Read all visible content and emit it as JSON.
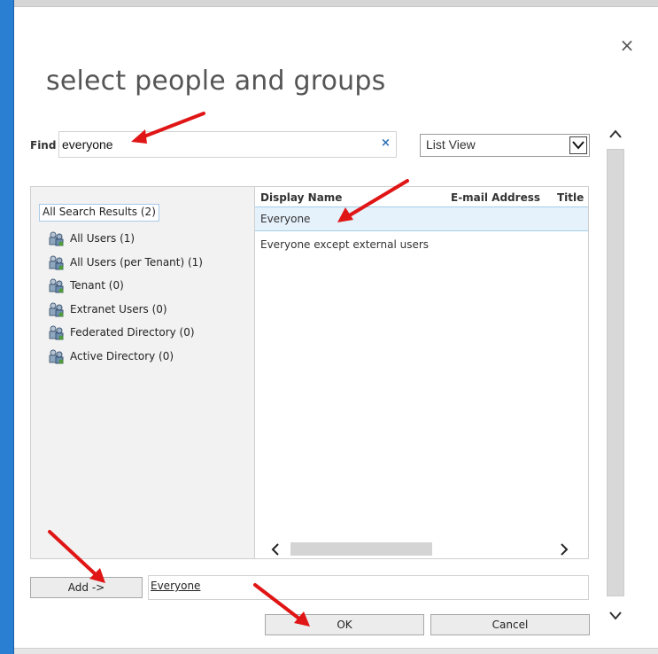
{
  "dialog": {
    "title": "select people and groups",
    "close_glyph": "×"
  },
  "find": {
    "label": "Find",
    "value": "everyone",
    "clear_glyph": "×"
  },
  "view": {
    "selected": "List View"
  },
  "tree": {
    "all_results": "All Search Results (2)",
    "items": [
      {
        "label": "All Users (1)"
      },
      {
        "label": "All Users (per Tenant) (1)"
      },
      {
        "label": "Tenant (0)"
      },
      {
        "label": "Extranet Users (0)"
      },
      {
        "label": "Federated Directory (0)"
      },
      {
        "label": "Active Directory (0)"
      }
    ],
    "icon": "group-icon"
  },
  "results": {
    "columns": [
      "Display Name",
      "E-mail Address",
      "Title"
    ],
    "rows": [
      {
        "display_name": "Everyone",
        "selected": true
      },
      {
        "display_name": "Everyone except external users",
        "selected": false
      }
    ]
  },
  "actions": {
    "add_label": "Add ->",
    "selected_entry": "Everyone",
    "ok_label": "OK",
    "cancel_label": "Cancel"
  },
  "colors": {
    "accent": "#2b7fd2",
    "annotation_arrow": "#e01515",
    "selected_row": "#e5f1fb"
  }
}
